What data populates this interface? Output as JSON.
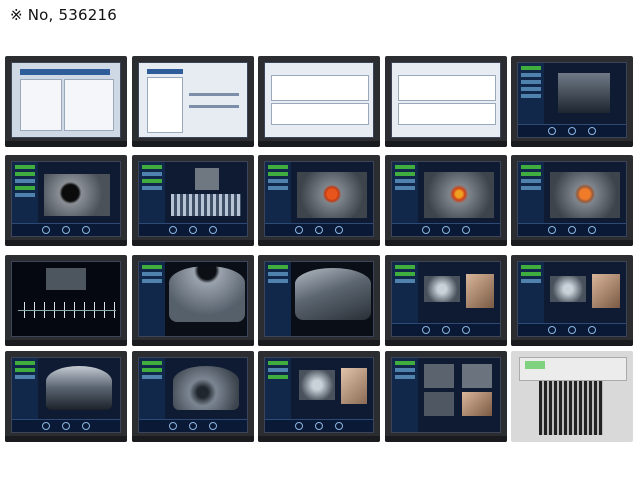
{
  "header": {
    "text": "※ No, 536216"
  }
}
